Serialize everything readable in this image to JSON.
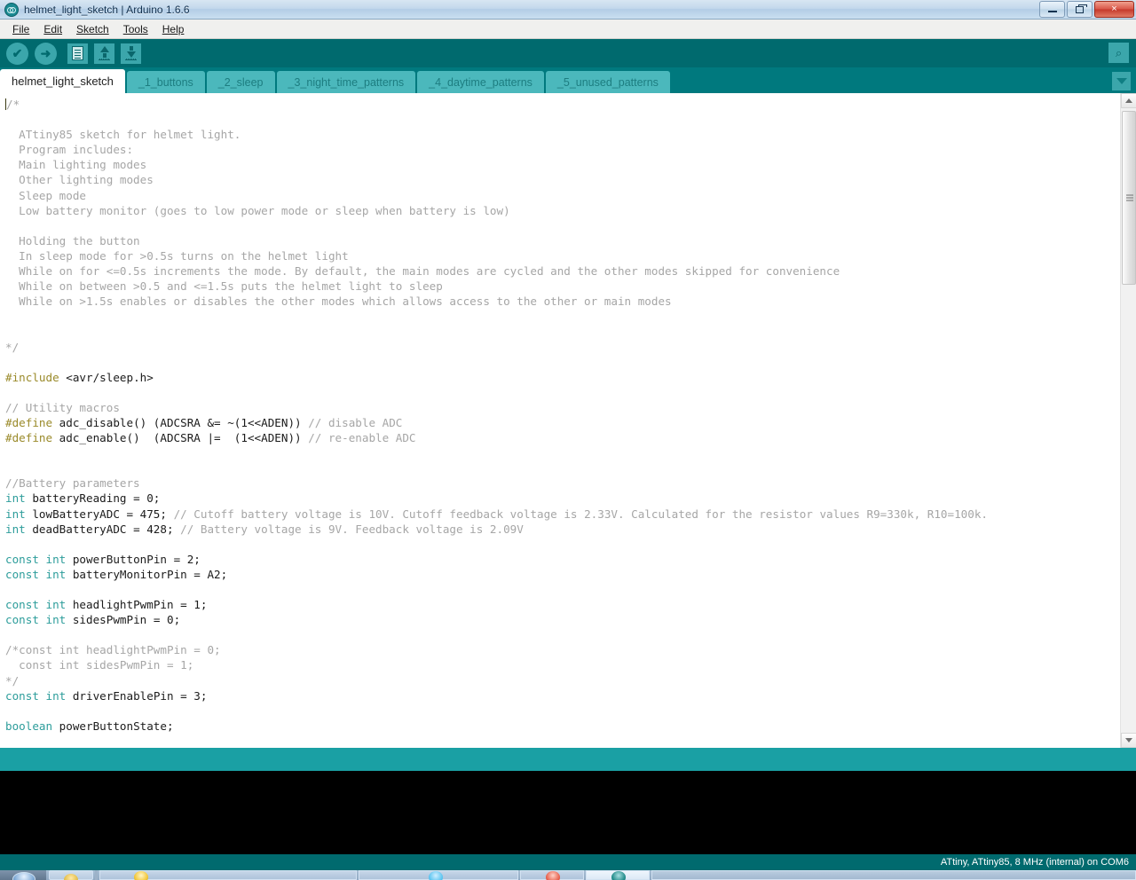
{
  "window": {
    "title": "helmet_light_sketch | Arduino 1.6.6",
    "app_icon": "arduino-infinity-icon",
    "controls": {
      "minimize": "minimize-button",
      "maximize": "maximize-button",
      "close": "×"
    }
  },
  "menu": {
    "items": [
      {
        "label": "File",
        "mnemonic": "F"
      },
      {
        "label": "Edit",
        "mnemonic": "E"
      },
      {
        "label": "Sketch",
        "mnemonic": "S"
      },
      {
        "label": "Tools",
        "mnemonic": "T"
      },
      {
        "label": "Help",
        "mnemonic": "H"
      }
    ]
  },
  "toolbar": {
    "verify": {
      "name": "verify-button",
      "glyph": "✔",
      "title": "Verify"
    },
    "upload": {
      "name": "upload-button",
      "glyph": "➜",
      "title": "Upload"
    },
    "new": {
      "name": "new-sketch-button",
      "title": "New"
    },
    "open": {
      "name": "open-sketch-button",
      "title": "Open"
    },
    "save": {
      "name": "save-sketch-button",
      "title": "Save"
    },
    "serial_monitor": {
      "name": "serial-monitor-button",
      "glyph": "⌕",
      "title": "Serial Monitor"
    }
  },
  "tabs": {
    "items": [
      {
        "label": "helmet_light_sketch",
        "active": true
      },
      {
        "label": "_1_buttons",
        "active": false
      },
      {
        "label": "_2_sleep",
        "active": false
      },
      {
        "label": "_3_night_time_patterns",
        "active": false
      },
      {
        "label": "_4_daytime_patterns",
        "active": false
      },
      {
        "label": "_5_unused_patterns",
        "active": false
      }
    ],
    "menu_button": "tab-menu-button"
  },
  "editor": {
    "lines": [
      [
        {
          "t": "caret"
        },
        {
          "t": "cmt",
          "s": "/*"
        }
      ],
      [],
      [
        {
          "t": "cmt",
          "s": "  ATtiny85 sketch for helmet light."
        }
      ],
      [
        {
          "t": "cmt",
          "s": "  Program includes:"
        }
      ],
      [
        {
          "t": "cmt",
          "s": "  Main lighting modes"
        }
      ],
      [
        {
          "t": "cmt",
          "s": "  Other lighting modes"
        }
      ],
      [
        {
          "t": "cmt",
          "s": "  Sleep mode"
        }
      ],
      [
        {
          "t": "cmt",
          "s": "  Low battery monitor (goes to low power mode or sleep when battery is low)"
        }
      ],
      [],
      [
        {
          "t": "cmt",
          "s": "  Holding the button"
        }
      ],
      [
        {
          "t": "cmt",
          "s": "  In sleep mode for >0.5s turns on the helmet light"
        }
      ],
      [
        {
          "t": "cmt",
          "s": "  While on for <=0.5s increments the mode. By default, the main modes are cycled and the other modes skipped for convenience"
        }
      ],
      [
        {
          "t": "cmt",
          "s": "  While on between >0.5 and <=1.5s puts the helmet light to sleep"
        }
      ],
      [
        {
          "t": "cmt",
          "s": "  While on >1.5s enables or disables the other modes which allows access to the other or main modes"
        }
      ],
      [],
      [],
      [
        {
          "t": "cmt",
          "s": "*/"
        }
      ],
      [],
      [
        {
          "t": "pre",
          "s": "#include"
        },
        {
          "t": "txt",
          "s": " <avr/sleep.h>"
        }
      ],
      [],
      [
        {
          "t": "cmt",
          "s": "// Utility macros"
        }
      ],
      [
        {
          "t": "pre",
          "s": "#define"
        },
        {
          "t": "txt",
          "s": " adc_disable() (ADCSRA &= ~(1<<ADEN)) "
        },
        {
          "t": "cmt",
          "s": "// disable ADC"
        }
      ],
      [
        {
          "t": "pre",
          "s": "#define"
        },
        {
          "t": "txt",
          "s": " adc_enable()  (ADCSRA |=  (1<<ADEN)) "
        },
        {
          "t": "cmt",
          "s": "// re-enable ADC"
        }
      ],
      [],
      [],
      [
        {
          "t": "cmt",
          "s": "//Battery parameters"
        }
      ],
      [
        {
          "t": "kw",
          "s": "int"
        },
        {
          "t": "txt",
          "s": " batteryReading = 0;"
        }
      ],
      [
        {
          "t": "kw",
          "s": "int"
        },
        {
          "t": "txt",
          "s": " lowBatteryADC = 475; "
        },
        {
          "t": "cmt",
          "s": "// Cutoff battery voltage is 10V. Cutoff feedback voltage is 2.33V. Calculated for the resistor values R9=330k, R10=100k."
        }
      ],
      [
        {
          "t": "kw",
          "s": "int"
        },
        {
          "t": "txt",
          "s": " deadBatteryADC = 428; "
        },
        {
          "t": "cmt",
          "s": "// Battery voltage is 9V. Feedback voltage is 2.09V"
        }
      ],
      [],
      [
        {
          "t": "kw",
          "s": "const int"
        },
        {
          "t": "txt",
          "s": " powerButtonPin = 2;"
        }
      ],
      [
        {
          "t": "kw",
          "s": "const int"
        },
        {
          "t": "txt",
          "s": " batteryMonitorPin = A2;"
        }
      ],
      [],
      [
        {
          "t": "kw",
          "s": "const int"
        },
        {
          "t": "txt",
          "s": " headlightPwmPin = 1;"
        }
      ],
      [
        {
          "t": "kw",
          "s": "const int"
        },
        {
          "t": "txt",
          "s": " sidesPwmPin = 0;"
        }
      ],
      [],
      [
        {
          "t": "cmt",
          "s": "/*const int headlightPwmPin = 0;"
        }
      ],
      [
        {
          "t": "cmt",
          "s": "  const int sidesPwmPin = 1;"
        }
      ],
      [
        {
          "t": "cmt",
          "s": "*/"
        }
      ],
      [
        {
          "t": "kw",
          "s": "const int"
        },
        {
          "t": "txt",
          "s": " driverEnablePin = 3;"
        }
      ],
      [],
      [
        {
          "t": "kw",
          "s": "boolean"
        },
        {
          "t": "txt",
          "s": " powerButtonState;"
        }
      ]
    ],
    "scrollbar": {
      "up_arrow": "scroll-up-arrow",
      "down_arrow": "scroll-down-arrow",
      "thumb": "scroll-thumb"
    }
  },
  "status": {
    "board_info": "ATtiny, ATtiny85, 8 MHz (internal) on COM6"
  },
  "colors": {
    "teal_dark": "#006a6e",
    "teal_mid": "#00797e",
    "teal_light": "#1aa0a4",
    "tab_inactive": "#4bb8bc",
    "comment": "#a6a6a6",
    "keyword": "#2d9d9b",
    "preprocessor": "#9a8a2a",
    "console_bg": "#000000"
  },
  "taskbar": {
    "items": [
      "start-orb",
      "explorer-icon",
      "browser-icon",
      "app-icon",
      "arduino-icon"
    ]
  }
}
